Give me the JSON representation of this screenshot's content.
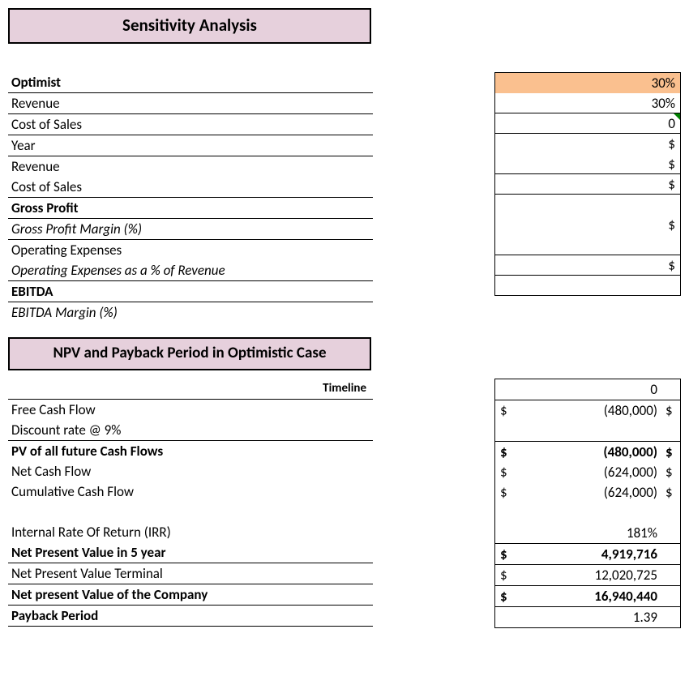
{
  "section1": {
    "title": "Sensitivity Analysis",
    "subheader": "Optimist",
    "rows": {
      "revenue_pct_label": "Revenue",
      "revenue_pct": "30%",
      "cos_pct_label": "Cost of Sales",
      "cos_pct": "30%",
      "year_label": "Year",
      "year": "0",
      "revenue_label": "Revenue",
      "revenue_sym": "$",
      "cos_label": "Cost of Sales",
      "cos_sym": "$",
      "gross_label": "Gross Profit",
      "gross_sym": "$",
      "gpm_label": "Gross Profit Margin (%)",
      "opex_label": "Operating Expenses",
      "opex_sym": "$",
      "opex_pct_label": "Operating Expenses as a % of Revenue",
      "ebitda_label": "EBITDA",
      "ebitda_sym": "$",
      "ebitda_margin_label": "EBITDA Margin (%)"
    }
  },
  "section2": {
    "title": "NPV and Payback Period in Optimistic Case",
    "timeline_label": "Timeline",
    "timeline_val": "0",
    "rows": {
      "fcf_label": "Free Cash Flow",
      "fcf_sym": "$",
      "fcf_val": "(480,000)",
      "fcf_trail": "$",
      "disc_label": "Discount rate @ 9%",
      "pv_label": "PV of all future Cash Flows",
      "pv_sym": "$",
      "pv_val": "(480,000)",
      "pv_trail": "$",
      "ncf_label": "Net Cash Flow",
      "ncf_sym": "$",
      "ncf_val": "(624,000)",
      "ncf_trail": "$",
      "ccf_label": "Cumulative Cash Flow",
      "ccf_sym": "$",
      "ccf_val": "(624,000)",
      "ccf_trail": "$",
      "irr_label": "Internal Rate Of Return (IRR)",
      "irr_val": "181%",
      "npv5_label": "Net Present Value in 5 year",
      "npv5_sym": "$",
      "npv5_val": "4,919,716",
      "npvt_label": "Net Present Value Terminal",
      "npvt_sym": "$",
      "npvt_val": "12,020,725",
      "npvc_label": "Net present Value of the Company",
      "npvc_sym": "$",
      "npvc_val": "16,940,440",
      "payback_label": "Payback Period",
      "payback_val": "1.39"
    }
  }
}
